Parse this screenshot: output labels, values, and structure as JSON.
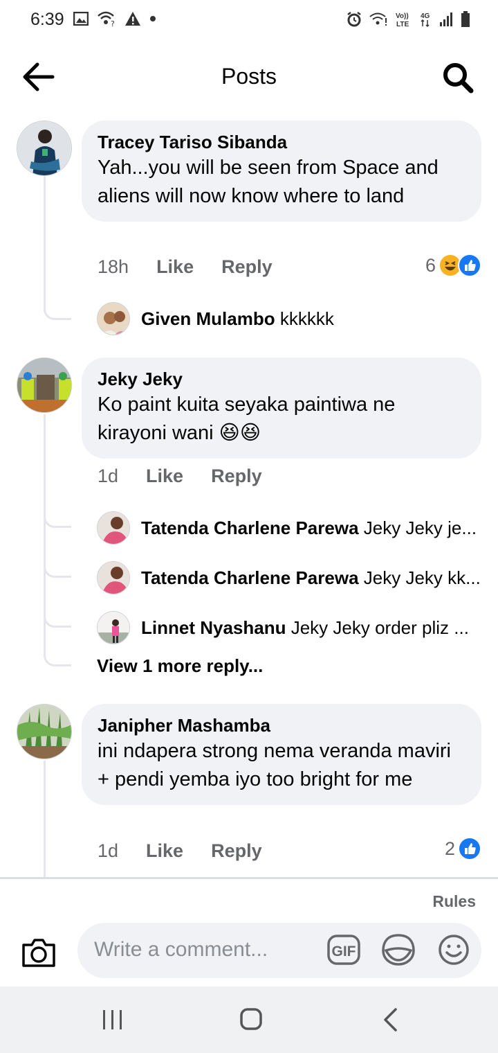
{
  "status_bar": {
    "time": "6:39",
    "left_icons": [
      "image-icon",
      "wifi-question-icon",
      "warning-icon",
      "dot-icon"
    ],
    "right_icons": [
      "alarm-icon",
      "wifi-icon",
      "volte-icon",
      "4g-icon",
      "signal-icon",
      "battery-icon"
    ],
    "volte_label": "Vo))\nLTE",
    "network_label": "4G"
  },
  "header": {
    "title": "Posts"
  },
  "comments": [
    {
      "author": "Tracey Tariso Sibanda",
      "text": "Yah...you will be seen from Space and aliens will now know where to land",
      "time": "18h",
      "like": "Like",
      "reply": "Reply",
      "reaction_count": "6",
      "reactions": [
        "haha",
        "like"
      ],
      "replies": [
        {
          "author": "Given Mulambo",
          "text": "kkkkkk"
        }
      ]
    },
    {
      "author": "Jeky Jeky",
      "text": "Ko paint kuita seyaka paintiwa ne kirayoni wani 😆😆",
      "time": "1d",
      "like": "Like",
      "reply": "Reply",
      "replies": [
        {
          "author": "Tatenda Charlene Parewa",
          "text": "Jeky Jeky je..."
        },
        {
          "author": "Tatenda Charlene Parewa",
          "text": "Jeky Jeky kk..."
        },
        {
          "author": "Linnet Nyashanu",
          "text": "Jeky Jeky order pliz ..."
        }
      ],
      "view_more": "View 1 more reply..."
    },
    {
      "author": "Janipher Mashamba",
      "text": "ini ndapera strong nema veranda maviri + pendi yemba iyo too bright for me",
      "time": "1d",
      "like": "Like",
      "reply": "Reply",
      "reaction_count": "2",
      "reactions": [
        "like"
      ]
    }
  ],
  "footer": {
    "rules": "Rules",
    "placeholder": "Write a comment...",
    "gif_label": "GIF"
  },
  "colors": {
    "bubble": "#f0f2f5",
    "muted": "#65676b",
    "like_blue": "#1877f2",
    "haha_yellow": "#f7b125"
  }
}
